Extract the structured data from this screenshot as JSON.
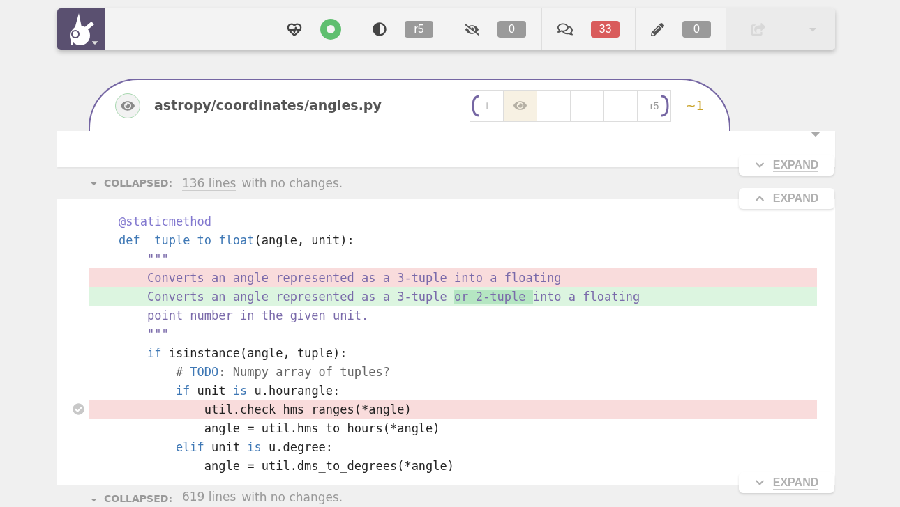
{
  "toolbar": {
    "health": {
      "healthy": true
    },
    "counters": [
      {
        "kind": "revision",
        "value": "r5",
        "color": "#9a9a9a"
      },
      {
        "kind": "unseen",
        "value": "0",
        "color": "#9a9a9a"
      },
      {
        "kind": "comments",
        "value": "33",
        "color": "#d95b5b"
      },
      {
        "kind": "edits",
        "value": "0",
        "color": "#9a9a9a"
      }
    ],
    "share": {
      "disabled": true
    }
  },
  "file": {
    "path": "astropy/coordinates/angles.py",
    "reviewed": false,
    "revisions": [
      {
        "kind": "label",
        "label": "⊥",
        "selected": false,
        "range_start": true,
        "range_end": false
      },
      {
        "kind": "eye",
        "selected": true,
        "range_start": false,
        "range_end": false
      },
      {
        "kind": "empty",
        "selected": false,
        "range_start": false,
        "range_end": false
      },
      {
        "kind": "empty",
        "selected": false,
        "range_start": false,
        "range_end": false
      },
      {
        "kind": "empty",
        "selected": false,
        "range_start": false,
        "range_end": false
      },
      {
        "kind": "label",
        "label": "r5",
        "selected": false,
        "range_start": false,
        "range_end": true
      }
    ],
    "delta": "~1"
  },
  "blocks": [
    {
      "kind": "collapsed",
      "label": "COLLAPSED:",
      "link": "136 lines",
      "rest": "with no changes.",
      "expand": [
        {
          "label": "EXPAND",
          "kind": "down"
        },
        {
          "label": "EXPAND",
          "kind": "up"
        }
      ]
    },
    {
      "kind": "code",
      "lines": [
        {
          "kind": "context",
          "tokens": [
            {
              "text": "@staticmethod",
              "kind": "decorator"
            }
          ]
        },
        {
          "kind": "context",
          "tokens": [
            {
              "text": "def",
              "kind": "keyword"
            },
            {
              "text": " _tuple_to_float",
              "kind": "keyword"
            },
            {
              "text": "(angle, unit):",
              "kind": "plain"
            }
          ]
        },
        {
          "kind": "context",
          "tokens": [
            {
              "text": "    \"\"\"",
              "kind": "string"
            }
          ]
        },
        {
          "kind": "removed",
          "tokens": [
            {
              "text": "    Converts an angle represented as a 3-tuple into a floating",
              "kind": "string"
            }
          ]
        },
        {
          "kind": "added",
          "tokens": [
            {
              "text": "    Converts an angle represented as a 3-tuple ",
              "kind": "string"
            },
            {
              "text": "or 2-tuple ",
              "kind": "string",
              "emph": true
            },
            {
              "text": "into a floating",
              "kind": "string"
            }
          ]
        },
        {
          "kind": "context",
          "tokens": [
            {
              "text": "    point number in the given unit.",
              "kind": "string"
            }
          ]
        },
        {
          "kind": "context",
          "tokens": [
            {
              "text": "    \"\"\"",
              "kind": "string"
            }
          ]
        },
        {
          "kind": "context",
          "tokens": [
            {
              "text": "    if",
              "kind": "keyword"
            },
            {
              "text": " isinstance(angle, tuple):",
              "kind": "plain"
            }
          ]
        },
        {
          "kind": "context",
          "tokens": [
            {
              "text": "        # ",
              "kind": "comment"
            },
            {
              "text": "TODO",
              "kind": "todo"
            },
            {
              "text": ": Numpy array of tuples?",
              "kind": "comment"
            }
          ]
        },
        {
          "kind": "context",
          "tokens": [
            {
              "text": "        if",
              "kind": "keyword"
            },
            {
              "text": " unit ",
              "kind": "plain"
            },
            {
              "text": "is",
              "kind": "keyword"
            },
            {
              "text": " u.hourangle:",
              "kind": "plain"
            }
          ]
        },
        {
          "kind": "removed",
          "marker": true,
          "tokens": [
            {
              "text": "            util.check_hms_ranges(*angle)",
              "kind": "plain"
            }
          ]
        },
        {
          "kind": "context",
          "tokens": [
            {
              "text": "            angle = util.hms_to_hours(*angle)",
              "kind": "plain"
            }
          ]
        },
        {
          "kind": "context",
          "tokens": [
            {
              "text": "        elif",
              "kind": "keyword"
            },
            {
              "text": " unit ",
              "kind": "plain"
            },
            {
              "text": "is",
              "kind": "keyword"
            },
            {
              "text": " u.degree:",
              "kind": "plain"
            }
          ]
        },
        {
          "kind": "context",
          "tokens": [
            {
              "text": "            angle = util.dms_to_degrees(*angle)",
              "kind": "plain"
            }
          ]
        }
      ]
    },
    {
      "kind": "collapsed",
      "label": "COLLAPSED:",
      "link": "619 lines",
      "rest": "with no changes.",
      "expand": [
        {
          "label": "EXPAND",
          "kind": "down"
        }
      ]
    }
  ]
}
